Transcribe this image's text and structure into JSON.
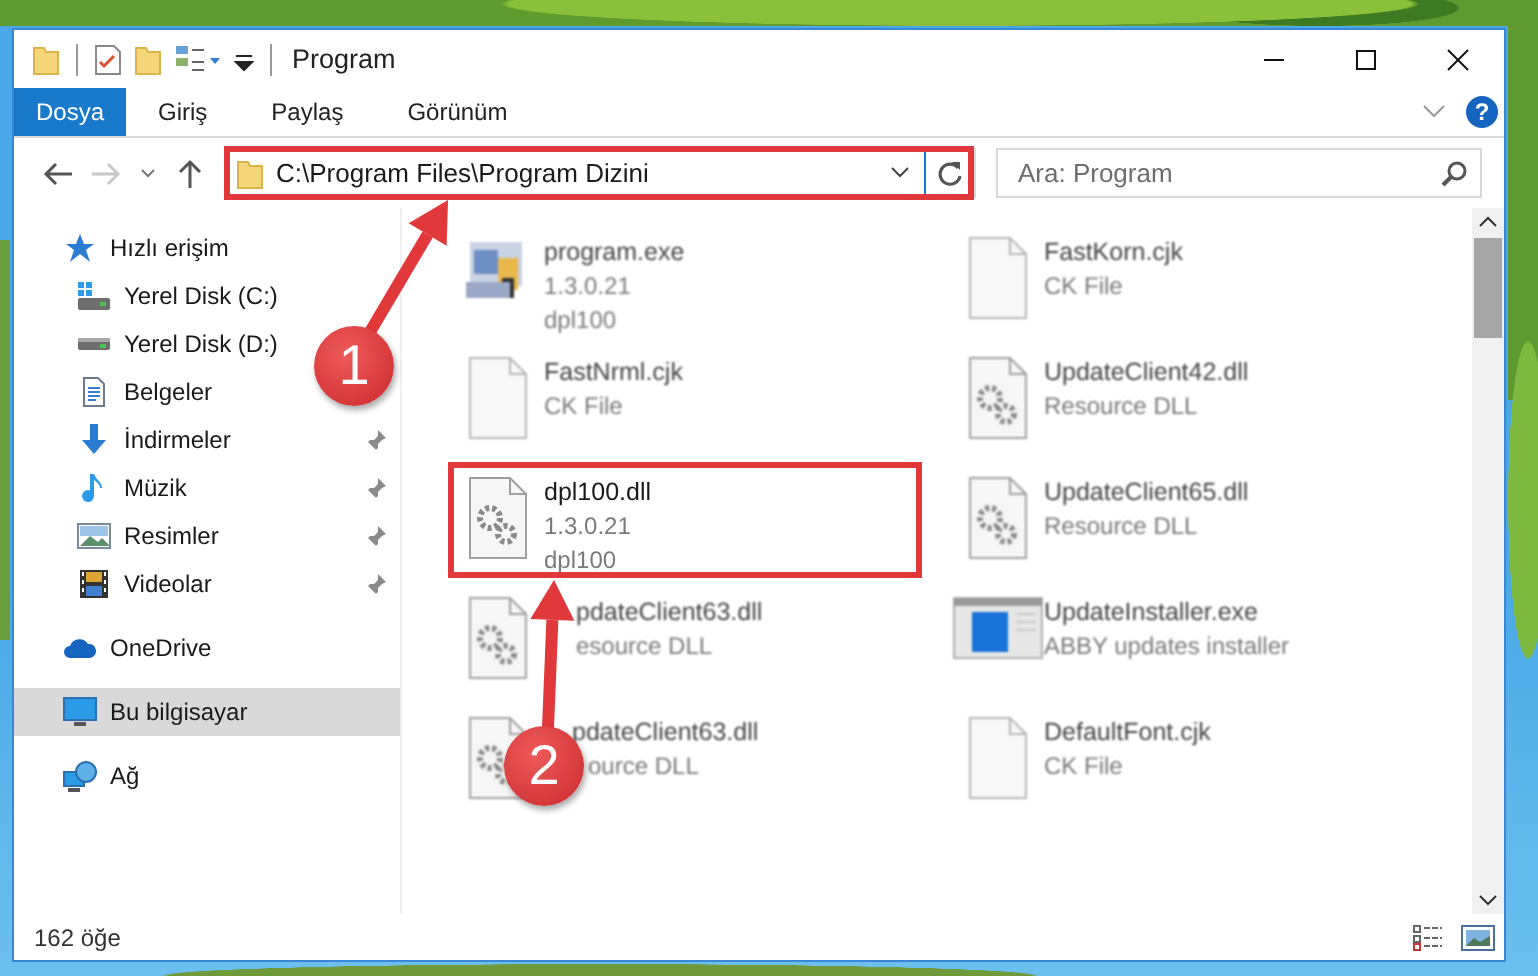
{
  "title_bar": {
    "title": "Program"
  },
  "ribbon": {
    "tabs": [
      {
        "label": "Dosya",
        "selected": true
      },
      {
        "label": "Giriş",
        "selected": false
      },
      {
        "label": "Paylaş",
        "selected": false
      },
      {
        "label": "Görünüm",
        "selected": false
      }
    ],
    "help": "?"
  },
  "address_bar": {
    "path": "C:\\Program Files\\Program Dizini"
  },
  "search": {
    "placeholder": "Ara: Program"
  },
  "navigation": [
    {
      "label": "Hızlı erişim",
      "kind": "star",
      "selected": false,
      "children": [
        {
          "label": "Yerel Disk (C:)",
          "kind": "system-drive",
          "pinned": false,
          "selected": false
        },
        {
          "label": "Yerel Disk (D:)",
          "kind": "drive",
          "pinned": false,
          "selected": false
        },
        {
          "label": "Belgeler",
          "kind": "documents",
          "pinned": false,
          "selected": false
        },
        {
          "label": "İndirmeler",
          "kind": "downloads",
          "pinned": true,
          "selected": false
        },
        {
          "label": "Müzik",
          "kind": "music",
          "pinned": true,
          "selected": false
        },
        {
          "label": "Resimler",
          "kind": "pictures",
          "pinned": true,
          "selected": false
        },
        {
          "label": "Videolar",
          "kind": "videos",
          "pinned": true,
          "selected": false
        }
      ]
    },
    {
      "label": "OneDrive",
      "kind": "cloud",
      "selected": false
    },
    {
      "label": "Bu bilgisayar",
      "kind": "computer",
      "selected": true
    },
    {
      "label": "Ağ",
      "kind": "network",
      "selected": false
    }
  ],
  "files": [
    {
      "name": "program.exe",
      "details": [
        "1.3.0.21",
        "dpl100"
      ],
      "kind": "application",
      "blurred": true
    },
    {
      "name": "FastKorn.cjk",
      "details": [
        "CK File"
      ],
      "kind": "document",
      "blurred": true
    },
    {
      "name": "FastNrml.cjk",
      "details": [
        "CK File"
      ],
      "kind": "document",
      "blurred": true
    },
    {
      "name": "UpdateClient42.dll",
      "details": [
        "Resource DLL"
      ],
      "kind": "library",
      "blurred": true
    },
    {
      "name": "dpl100.dll",
      "details": [
        "1.3.0.21",
        "dpl100"
      ],
      "kind": "library",
      "blurred": false
    },
    {
      "name": "UpdateClient65.dll",
      "details": [
        "Resource DLL"
      ],
      "kind": "library",
      "blurred": true
    },
    {
      "name": "pdateClient63.dll",
      "details": [
        "esource DLL"
      ],
      "kind": "library",
      "blurred": true
    },
    {
      "name": "UpdateInstaller.exe",
      "details": [
        "ABBY updates installer"
      ],
      "kind": "installer",
      "blurred": true
    },
    {
      "name": "pdateClient63.dll",
      "details": [
        "ource DLL"
      ],
      "kind": "library",
      "blurred": true
    },
    {
      "name": "DefaultFont.cjk",
      "details": [
        "CK File"
      ],
      "kind": "document",
      "blurred": true
    }
  ],
  "status_bar": {
    "item_count": "162 öğe"
  },
  "callouts": [
    {
      "number": "1"
    },
    {
      "number": "2"
    }
  ]
}
